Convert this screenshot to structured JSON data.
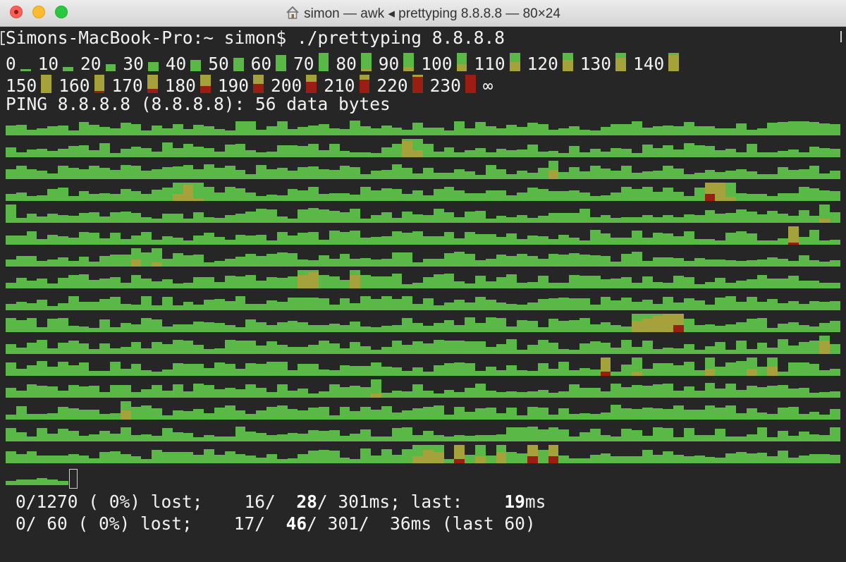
{
  "window": {
    "title": "simon — awk ◂ prettyping 8.8.8.8 — 80×24",
    "icon": "house-icon"
  },
  "terminal": {
    "prompt_line": "Simons-MacBook-Pro:~ simon$ ./prettyping 8.8.8.8",
    "legend_labels": [
      "0",
      "10",
      "20",
      "30",
      "40",
      "50",
      "60",
      "70",
      "80",
      "90",
      "100",
      "110",
      "120",
      "130",
      "140",
      "150",
      "160",
      "170",
      "180",
      "190",
      "200",
      "210",
      "220",
      "230",
      "∞"
    ],
    "ping_header": "PING 8.8.8.8 (8.8.8.8): 56 data bytes",
    "stats": [
      {
        "lost": "0/1270 ( 0%) lost;",
        "min": "16/",
        "avg": "28",
        "rest": "/ 301ms; last:",
        "last": "19",
        "unit": "ms"
      },
      {
        "lost": "0/ 60 ( 0%) lost;",
        "min": "17/",
        "avg": "46",
        "rest": "/ 301/  36ms (last 60)",
        "last": "",
        "unit": ""
      }
    ]
  },
  "colors": {
    "background": "#262626",
    "green": "#5ab946",
    "yellow": "#a5a23c",
    "red": "#9b1e14",
    "text": "#f2f2f2"
  }
}
